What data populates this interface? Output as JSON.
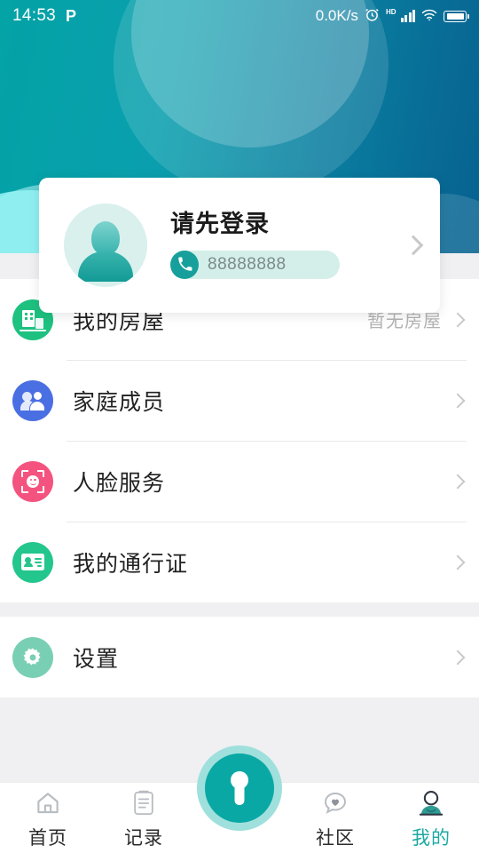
{
  "statusbar": {
    "time": "14:53",
    "carrier_icon_label": "P",
    "net_speed": "0.0K/s",
    "alarm_icon": "alarm-clock-icon",
    "hd_label": "HD",
    "signal_icon": "signal-bars-icon",
    "wifi_icon": "wifi-icon",
    "battery_icon": "battery-full-icon"
  },
  "login_card": {
    "title": "请先登录",
    "phone": "88888888",
    "phone_icon": "phone-icon",
    "avatar_icon": "default-avatar-icon",
    "chevron": "chevron-right-icon"
  },
  "menu": {
    "group1": [
      {
        "label": "我的房屋",
        "value": "暂无房屋",
        "icon": "building-icon",
        "icon_color": "#1ec17f"
      },
      {
        "label": "家庭成员",
        "value": "",
        "icon": "family-members-icon",
        "icon_color": "#4a6fe3"
      },
      {
        "label": "人脸服务",
        "value": "",
        "icon": "face-scan-icon",
        "icon_color": "#f4537f"
      },
      {
        "label": "我的通行证",
        "value": "",
        "icon": "id-card-icon",
        "icon_color": "#23c68c"
      }
    ],
    "group2": [
      {
        "label": "设置",
        "value": "",
        "icon": "gear-icon",
        "icon_color": "#79cfb4"
      }
    ]
  },
  "bottom_nav": {
    "tabs": [
      {
        "label": "首页",
        "icon": "home-icon",
        "active": false
      },
      {
        "label": "记录",
        "icon": "clipboard-records-icon",
        "active": false
      },
      {
        "label": "社区",
        "icon": "community-heart-icon",
        "active": false
      },
      {
        "label": "我的",
        "icon": "profile-icon",
        "active": true
      }
    ],
    "fab": {
      "icon": "keyhole-unlock-icon"
    }
  },
  "theme": {
    "accent": "#0aa8a5",
    "header_gradient_start": "#03a3a6",
    "header_gradient_end": "#076190",
    "page_bg": "#f0f0f2",
    "active_tab_color": "#1aa9a2"
  }
}
